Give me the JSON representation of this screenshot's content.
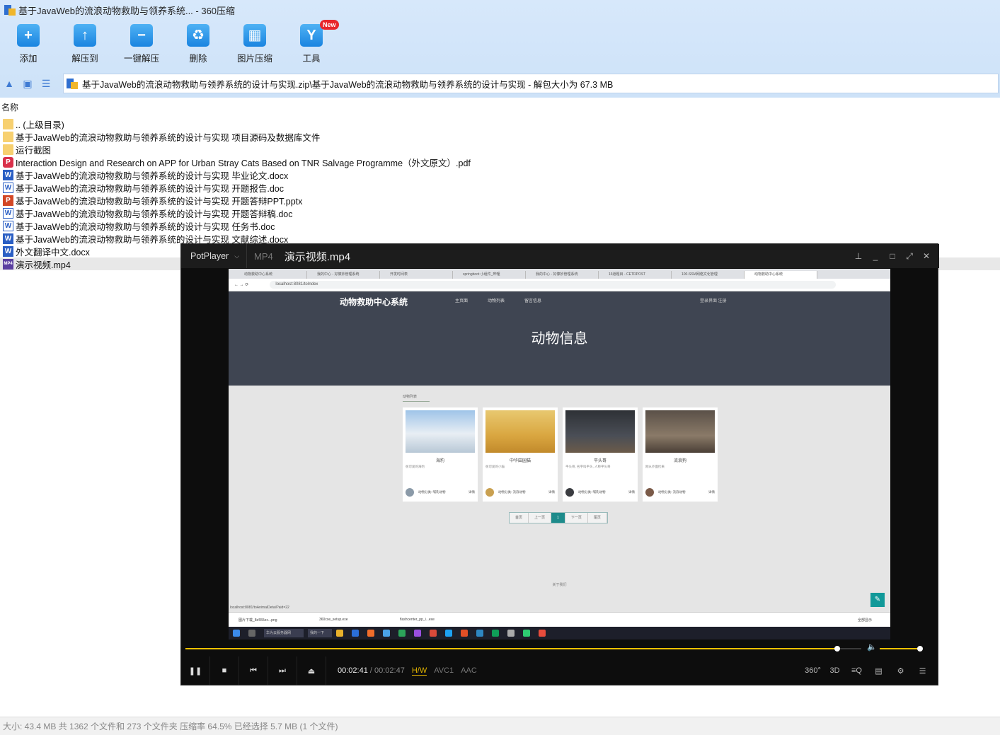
{
  "window": {
    "title": "基于JavaWeb的流浪动物救助与领养系统... - 360压缩"
  },
  "toolbar": [
    {
      "label": "添加",
      "icon": "add-icon",
      "glyph": "+"
    },
    {
      "label": "解压到",
      "icon": "extract-to-icon",
      "glyph": "↑"
    },
    {
      "label": "一键解压",
      "icon": "one-click-extract-icon",
      "glyph": "−"
    },
    {
      "label": "删除",
      "icon": "delete-icon",
      "glyph": "♻"
    },
    {
      "label": "图片压缩",
      "icon": "image-compress-icon",
      "glyph": "▦"
    },
    {
      "label": "工具",
      "icon": "tools-icon",
      "glyph": "Y",
      "badge": "New"
    }
  ],
  "path": {
    "text": "基于JavaWeb的流浪动物救助与领养系统的设计与实现.zip\\基于JavaWeb的流浪动物救助与领养系统的设计与实现 - 解包大小为 67.3 MB"
  },
  "list": {
    "column_name": "名称",
    "files": [
      {
        "name": ".. (上级目录)",
        "type": "folder"
      },
      {
        "name": "基于JavaWeb的流浪动物救助与领养系统的设计与实现 项目源码及数据库文件",
        "type": "folder"
      },
      {
        "name": "运行截图",
        "type": "folder"
      },
      {
        "name": "Interaction Design and Research on APP for Urban Stray Cats Based on TNR Salvage Programme（外文原文）.pdf",
        "type": "pdf"
      },
      {
        "name": "基于JavaWeb的流浪动物救助与领养系统的设计与实现 毕业论文.docx",
        "type": "word"
      },
      {
        "name": "基于JavaWeb的流浪动物救助与领养系统的设计与实现 开题报告.doc",
        "type": "word-o"
      },
      {
        "name": "基于JavaWeb的流浪动物救助与领养系统的设计与实现 开题答辩PPT.pptx",
        "type": "ppt"
      },
      {
        "name": "基于JavaWeb的流浪动物救助与领养系统的设计与实现 开题答辩稿.doc",
        "type": "word-o"
      },
      {
        "name": "基于JavaWeb的流浪动物救助与领养系统的设计与实现 任务书.doc",
        "type": "word-o"
      },
      {
        "name": "基于JavaWeb的流浪动物救助与领养系统的设计与实现 文献综述.docx",
        "type": "word"
      },
      {
        "name": "外文翻译中文.docx",
        "type": "word"
      },
      {
        "name": "演示视频.mp4",
        "type": "mp4",
        "selected": true
      }
    ]
  },
  "status": "大小: 43.4 MB 共 1362 个文件和 273 个文件夹 压缩率 64.5% 已经选择 5.7 MB (1 个文件)",
  "player": {
    "brand": "PotPlayer",
    "format": "MP4",
    "file": "演示视频.mp4",
    "current_time": "00:02:41",
    "total_time": "/ 00:02:47",
    "hw": "H/W",
    "video_codec": "AVC1",
    "audio_codec": "AAC",
    "progress_fraction": 0.964,
    "volume_fraction": 0.95,
    "right_buttons": [
      "360°",
      "3D",
      "≡Q",
      "▤",
      "⚙",
      "☰"
    ]
  },
  "video": {
    "tabs": [
      "动物救助中心系统",
      "我的中心 - 好慷妙管理系统",
      "开发时间表",
      "springboot 小组件_哔哩",
      "我的中心 - 好慷妙管理系统",
      "16道题目 - CETRPOST",
      "100-SSM网络文化管理",
      "动物救助中心系统"
    ],
    "url": "localhost:8081/toIndex",
    "site_brand": "动物救助中心系统",
    "nav": [
      "主页面",
      "动物列表",
      "留言信息"
    ],
    "auth": "登录界面   注册",
    "heading": "动物信息",
    "section": "动物列表",
    "cards": [
      {
        "name": "海豹",
        "desc": "很可爱的海豹",
        "owner": "动物分类: 哺乳动物",
        "like": "详情"
      },
      {
        "name": "中华田园猫",
        "desc": "很可爱的小猫",
        "owner": "动物分类: 流浪动物",
        "like": "详情"
      },
      {
        "name": "平头哥",
        "desc": "平头哥, 名字叫平头, 人称平头哥",
        "owner": "动物分类: 哺乳动物",
        "like": "详情"
      },
      {
        "name": "流浪狗",
        "desc": "刚从外面捡来",
        "owner": "动物分类: 流浪动物",
        "like": "详情"
      }
    ],
    "pager": [
      "首页",
      "上一页",
      "1",
      "下一页",
      "尾页"
    ],
    "footer": "关于我们",
    "status_url": "localhost:8081/toAnimalDetail?aid=22",
    "downloads": [
      "图片下载_8e555ec...png",
      "360cse_setup.exe",
      "flashcenter_pp_i...exe"
    ],
    "downloads_all": "全部显示",
    "taskbar_task": "华为云服务器网",
    "taskbar_task2": "我的一下"
  },
  "colors": {
    "ribbon": "#d7e8fb",
    "accent": "#f2c100",
    "teal": "#1d8b8b"
  }
}
